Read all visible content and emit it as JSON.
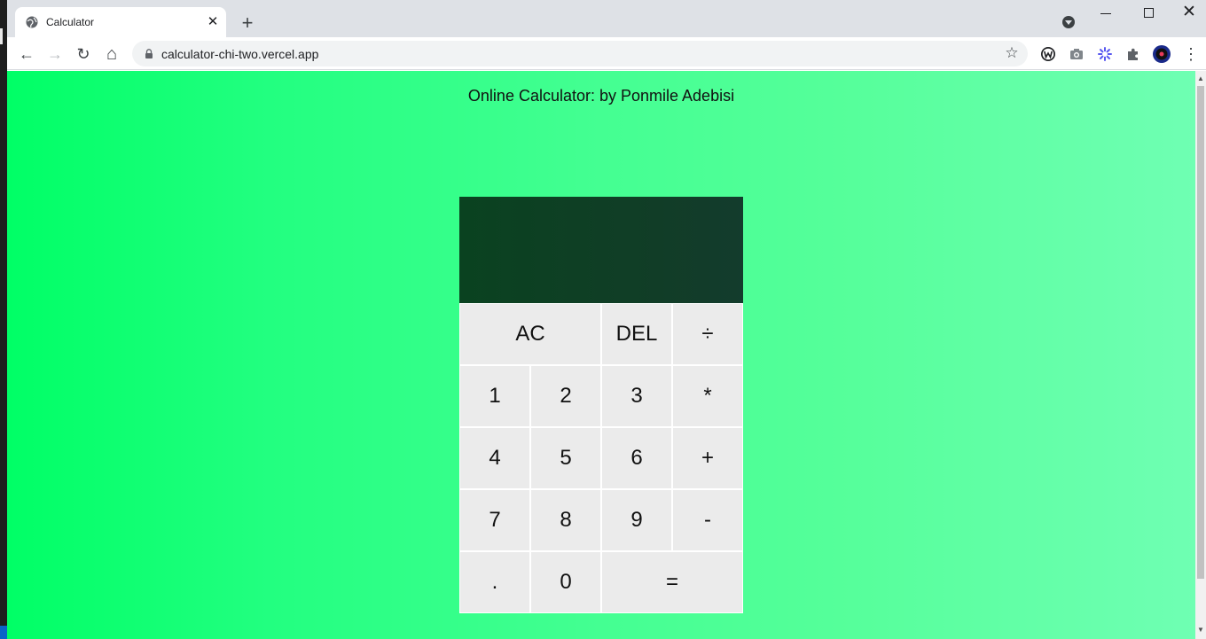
{
  "browser": {
    "tab": {
      "title": "Calculator",
      "close_glyph": "✕"
    },
    "new_tab_glyph": "+",
    "window_close_glyph": "✕",
    "nav": {
      "back_glyph": "←",
      "forward_glyph": "→",
      "reload_glyph": "↻",
      "home_glyph": "⌂"
    },
    "url": "calculator-chi-two.vercel.app",
    "bookmark_glyph": "☆",
    "menu_glyph": "⋮",
    "extensions": [
      "w-extension-icon",
      "camera-icon",
      "puzzle-extension-icon",
      "extensions-icon",
      "profile-avatar-icon"
    ]
  },
  "page": {
    "heading": "Online Calculator: by Ponmile Adebisi"
  },
  "calculator": {
    "display": {
      "previous": "",
      "current": ""
    },
    "keys": {
      "ac": "AC",
      "del": "DEL",
      "divide": "÷",
      "one": "1",
      "two": "2",
      "three": "3",
      "multiply": "*",
      "four": "4",
      "five": "5",
      "six": "6",
      "plus": "+",
      "seven": "7",
      "eight": "8",
      "nine": "9",
      "minus": "-",
      "dot": ".",
      "zero": "0",
      "equals": "="
    }
  },
  "colors": {
    "background_start": "#00ff66",
    "background_end": "#6fffb3",
    "display": "#0a4220",
    "key": "#ebebeb"
  }
}
